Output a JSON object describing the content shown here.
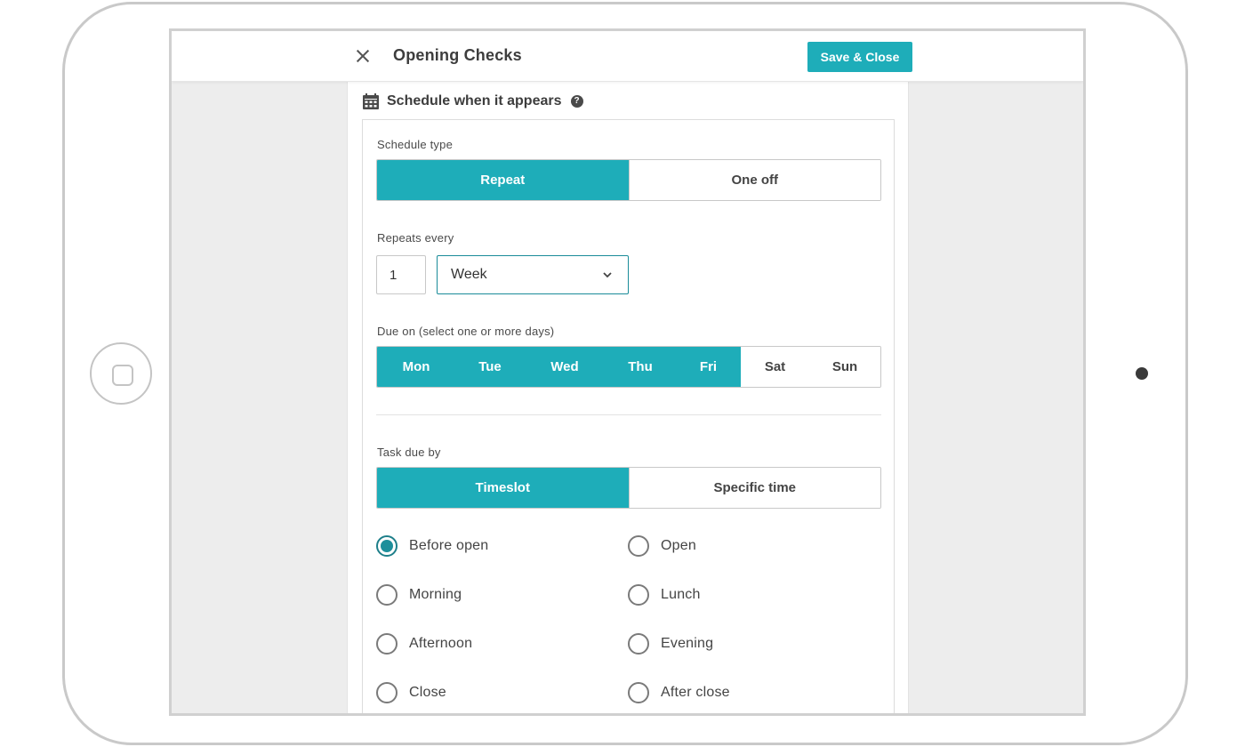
{
  "header": {
    "title": "Opening Checks",
    "save_label": "Save & Close"
  },
  "schedule": {
    "heading": "Schedule when it appears",
    "help": "?",
    "schedule_type_label": "Schedule type",
    "schedule_types": [
      {
        "label": "Repeat",
        "selected": true
      },
      {
        "label": "One off",
        "selected": false
      }
    ],
    "repeats_every_label": "Repeats every",
    "repeat_count": "1",
    "repeat_unit": "Week",
    "due_on_label": "Due on (select one or more days)",
    "days": [
      {
        "label": "Mon",
        "selected": true
      },
      {
        "label": "Tue",
        "selected": true
      },
      {
        "label": "Wed",
        "selected": true
      },
      {
        "label": "Thu",
        "selected": true
      },
      {
        "label": "Fri",
        "selected": true
      },
      {
        "label": "Sat",
        "selected": false
      },
      {
        "label": "Sun",
        "selected": false
      }
    ],
    "task_due_by_label": "Task due by",
    "due_by_modes": [
      {
        "label": "Timeslot",
        "selected": true
      },
      {
        "label": "Specific time",
        "selected": false
      }
    ],
    "timeslots": [
      {
        "label": "Before open",
        "selected": true
      },
      {
        "label": "Open",
        "selected": false
      },
      {
        "label": "Morning",
        "selected": false
      },
      {
        "label": "Lunch",
        "selected": false
      },
      {
        "label": "Afternoon",
        "selected": false
      },
      {
        "label": "Evening",
        "selected": false
      },
      {
        "label": "Close",
        "selected": false
      },
      {
        "label": "After close",
        "selected": false
      }
    ]
  },
  "colors": {
    "accent": "#1eadb9",
    "background": "#ededed",
    "text": "#444444"
  }
}
